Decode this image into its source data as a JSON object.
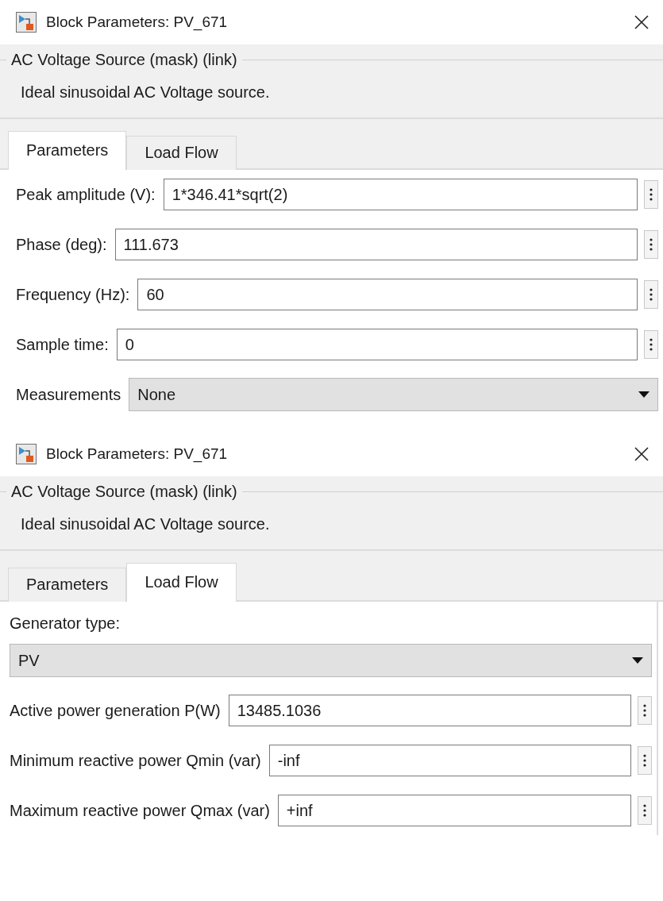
{
  "dialogs": [
    {
      "title": "Block Parameters: PV_671",
      "group_title": "AC Voltage Source (mask) (link)",
      "description": "Ideal sinusoidal AC Voltage source.",
      "tabs": [
        {
          "label": "Parameters",
          "selected": true
        },
        {
          "label": "Load Flow",
          "selected": false
        }
      ],
      "fields": [
        {
          "kind": "edit",
          "label": "Peak amplitude (V):",
          "value": "1*346.41*sqrt(2)"
        },
        {
          "kind": "edit",
          "label": "Phase (deg):",
          "value": "111.673"
        },
        {
          "kind": "edit",
          "label": "Frequency (Hz):",
          "value": "60"
        },
        {
          "kind": "edit",
          "label": "Sample time:",
          "value": "0"
        },
        {
          "kind": "popup",
          "label": "Measurements",
          "value": "None"
        }
      ]
    },
    {
      "title": "Block Parameters: PV_671",
      "group_title": "AC Voltage Source (mask) (link)",
      "description": "Ideal sinusoidal AC Voltage source.",
      "tabs": [
        {
          "label": "Parameters",
          "selected": false
        },
        {
          "label": "Load Flow",
          "selected": true
        }
      ],
      "fields": [
        {
          "kind": "popup-below",
          "label": "Generator type:",
          "value": "PV"
        },
        {
          "kind": "edit",
          "label": "Active power generation P(W)",
          "value": "13485.1036"
        },
        {
          "kind": "edit",
          "label": "Minimum reactive power Qmin (var)",
          "value": "-inf"
        },
        {
          "kind": "edit",
          "label": "Maximum reactive power Qmax (var)",
          "value": "+inf"
        }
      ]
    }
  ]
}
